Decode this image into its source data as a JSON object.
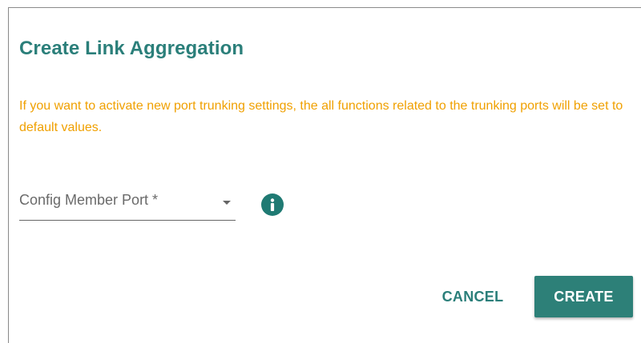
{
  "dialog": {
    "title": "Create Link Aggregation",
    "warning_text": "If you want to activate new port trunking settings, the all functions related to the trunking ports will be set to default values.",
    "member_port_field": {
      "label": "Config Member Port *"
    },
    "info_icon": "info-icon",
    "actions": {
      "cancel_label": "CANCEL",
      "create_label": "CREATE"
    }
  },
  "colors": {
    "title": "#2b7f7a",
    "warning": "#f0a000",
    "primary_button": "#2d8078",
    "info_icon": "#1f7a73"
  }
}
